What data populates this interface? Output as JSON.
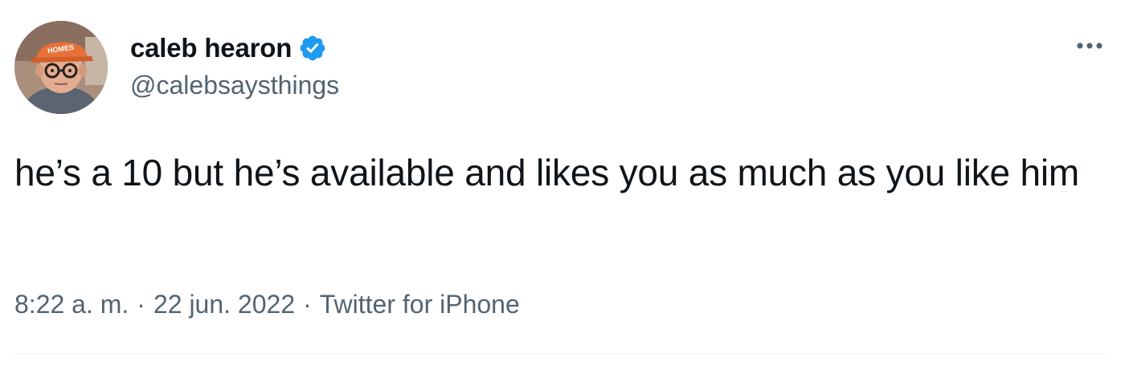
{
  "tweet": {
    "author": {
      "display_name": "caleb hearon",
      "handle": "@calebsaysthings",
      "verified": true,
      "avatar_icon": "profile-photo-man-orange-cap-glasses"
    },
    "text": "he’s a 10 but he’s available and likes you as much as you like him",
    "meta": {
      "time": "8:22 a. m.",
      "date": "22 jun. 2022",
      "source": "Twitter for iPhone",
      "separator": "·"
    },
    "more_icon": "more-horizontal-icon"
  },
  "colors": {
    "text_primary": "#0f1419",
    "text_secondary": "#536471",
    "verified_blue": "#1d9bf0",
    "divider": "#eff3f4",
    "background": "#ffffff"
  }
}
